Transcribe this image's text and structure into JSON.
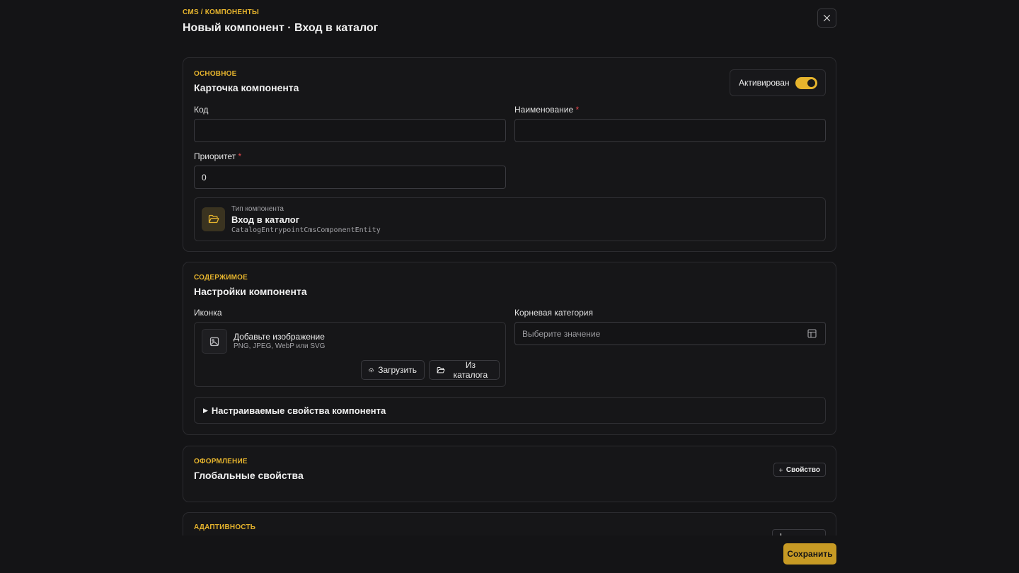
{
  "header": {
    "breadcrumb": "CMS / КОМПОНЕНТЫ",
    "title": "Новый компонент · Вход в каталог"
  },
  "basic": {
    "kicker": "ОСНОВНОЕ",
    "title": "Карточка компонента",
    "active_label": "Активирован",
    "active": true,
    "code_label": "Код",
    "code_value": "",
    "name_label": "Наименование",
    "name_value": "",
    "priority_label": "Приоритет",
    "priority_value": "0",
    "required_mark": "*",
    "type_caption": "Тип компонента",
    "type_name": "Вход в каталог",
    "type_entity": "CatalogEntrypointCmsComponentEntity"
  },
  "content": {
    "kicker": "СОДЕРЖИМОЕ",
    "title": "Настройки компонента",
    "icon_label": "Иконка",
    "upload_title": "Добавьте изображение",
    "upload_hint": "PNG, JPEG, WebP или SVG",
    "upload_button": "Загрузить",
    "catalog_button": "Из каталога",
    "root_category_label": "Корневая категория",
    "root_category_placeholder": "Выберите значение",
    "details_caret": "▶",
    "details_label": "Настраиваемые свойства компонента"
  },
  "design": {
    "kicker": "ОФОРМЛЕНИЕ",
    "title": "Глобальные свойства",
    "add_property_button": "Свойство"
  },
  "adaptive": {
    "kicker": "АДАПТИВНОСТЬ"
  },
  "footer": {
    "save_button": "Сохранить"
  },
  "colors": {
    "accent": "#e6b42d",
    "background": "#141416",
    "required": "#e5484d"
  },
  "icons": [
    "close-icon",
    "folder-open-icon",
    "image-icon",
    "cloud-upload-icon",
    "table-icon",
    "plus-icon"
  ]
}
